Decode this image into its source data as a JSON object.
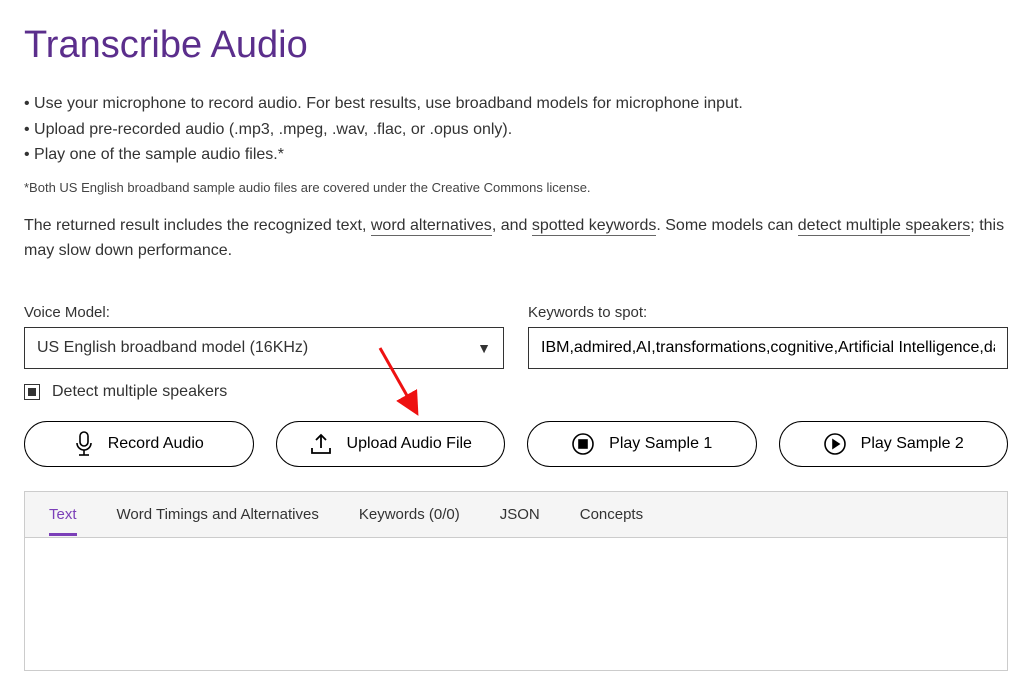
{
  "title": "Transcribe Audio",
  "bullets": [
    "Use your microphone to record audio. For best results, use broadband models for microphone input.",
    "Upload pre-recorded audio (.mp3, .mpeg, .wav, .flac, or .opus only).",
    "Play one of the sample audio files.*"
  ],
  "footnote": "*Both US English broadband sample audio files are covered under the Creative Commons license.",
  "desc": {
    "pre": "The returned result includes the recognized text, ",
    "link1": "word alternatives",
    "mid1": ", and ",
    "link2": "spotted keywords",
    "mid2": ". Some models can ",
    "link3": "detect multiple speakers",
    "post": "; this may slow down performance."
  },
  "form": {
    "voice_model_label": "Voice Model:",
    "voice_model_value": "US English broadband model (16KHz)",
    "keywords_label": "Keywords to spot:",
    "keywords_value": "IBM,admired,AI,transformations,cognitive,Artificial Intelligence,data",
    "detect_label": "Detect multiple speakers"
  },
  "buttons": {
    "record": "Record Audio",
    "upload": "Upload Audio File",
    "sample1": "Play Sample 1",
    "sample2": "Play Sample 2"
  },
  "tabs": {
    "text": "Text",
    "timings": "Word Timings and Alternatives",
    "keywords": "Keywords (0/0)",
    "json": "JSON",
    "concepts": "Concepts"
  }
}
